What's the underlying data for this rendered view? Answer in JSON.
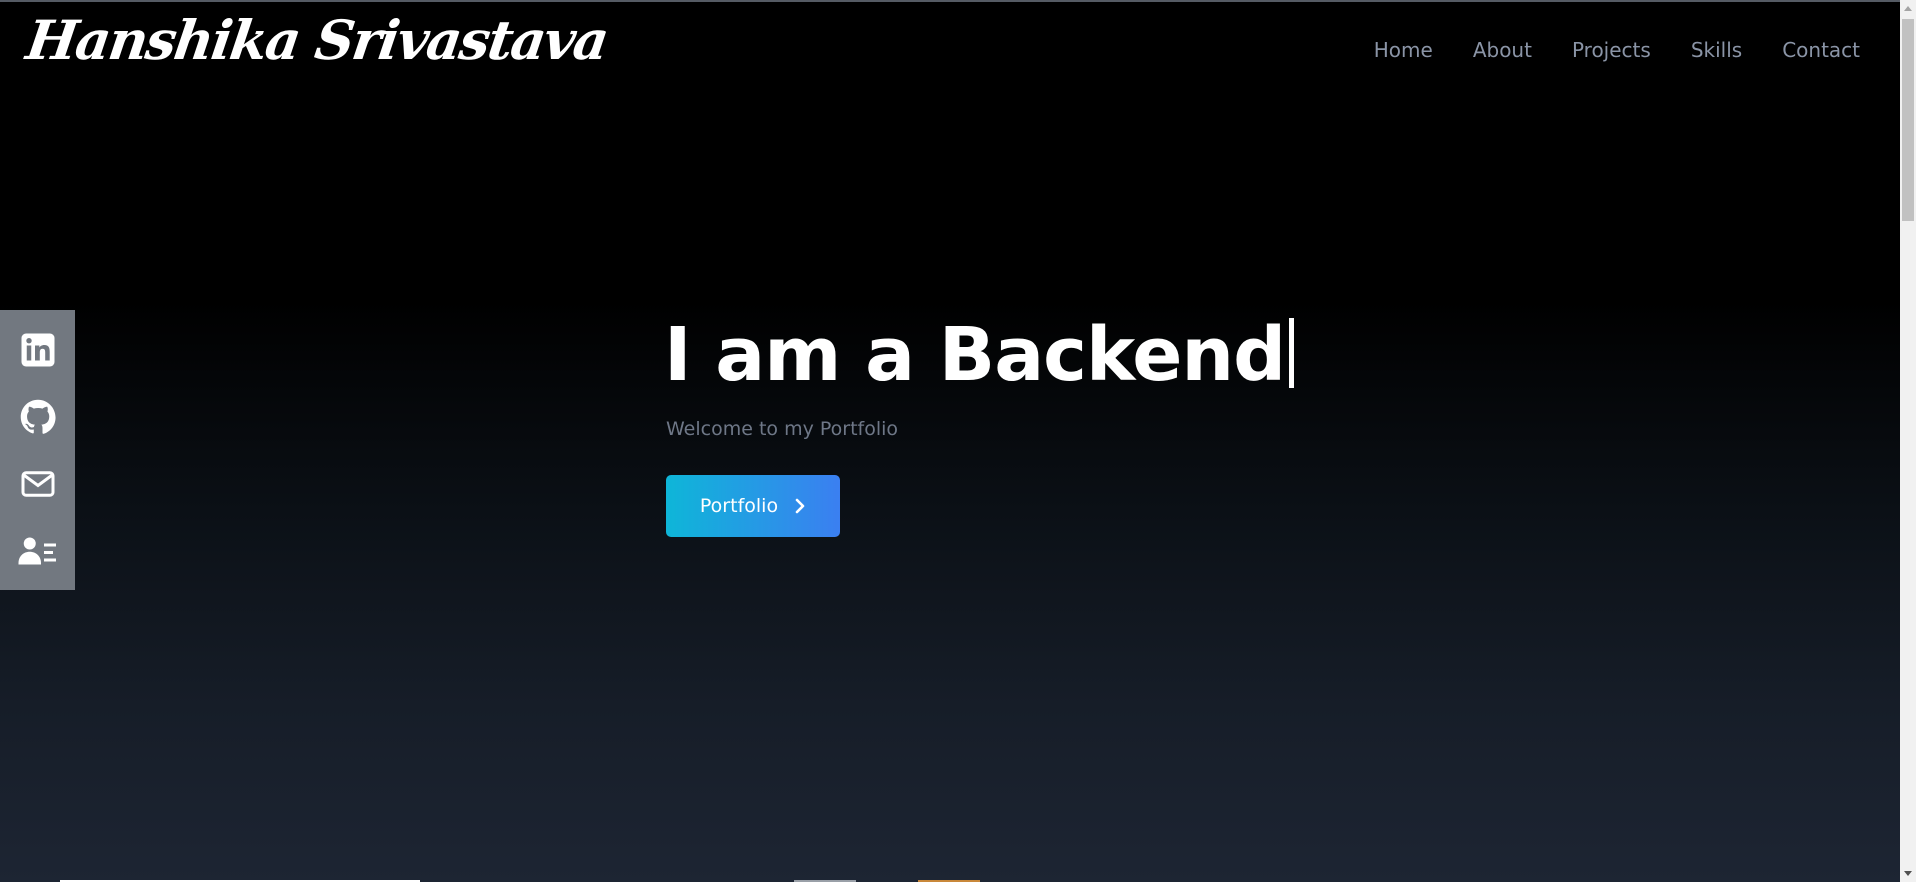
{
  "brand": {
    "name": "Hanshika Srivastava"
  },
  "nav": {
    "items": [
      {
        "label": "Home"
      },
      {
        "label": "About"
      },
      {
        "label": "Projects"
      },
      {
        "label": "Skills"
      },
      {
        "label": "Contact"
      }
    ]
  },
  "social": {
    "items": [
      {
        "icon": "linkedin-icon"
      },
      {
        "icon": "github-icon"
      },
      {
        "icon": "mail-icon"
      },
      {
        "icon": "resume-icon"
      }
    ]
  },
  "hero": {
    "title": "I am a Backend",
    "subtitle": "Welcome to my Portfolio",
    "cta_label": "Portfolio",
    "cta_icon": "chevron-right-icon"
  },
  "colors": {
    "background_top": "#000000",
    "background_bottom": "#1d2533",
    "nav_text": "#8a94a6",
    "subtitle_text": "#6e7787",
    "social_bar": "#727880",
    "button_gradient_start": "#0eb6d8",
    "button_gradient_end": "#3b7ff1"
  }
}
